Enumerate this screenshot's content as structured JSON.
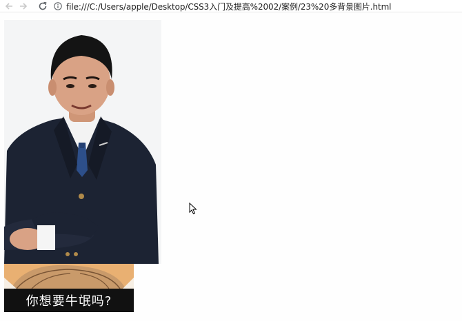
{
  "browser": {
    "address_url": "file:///C:/Users/apple/Desktop/CSS3入门及提高%2002/案例/23%20多背景图片.html",
    "icons": {
      "back": "back-arrow-icon",
      "forward": "forward-arrow-icon",
      "reload": "reload-icon",
      "page_info": "info-icon"
    }
  },
  "page": {
    "background_images": [
      {
        "name": "portrait-photo",
        "description_color": "#f4f5f6"
      },
      {
        "name": "comic-image",
        "caption": "你想要牛氓吗?"
      }
    ]
  },
  "colors": {
    "suit": "#1c2333",
    "skin": "#d9a285",
    "hair": "#141414",
    "comic_orange": "#f1a94a",
    "caption_bg": "#111111"
  }
}
